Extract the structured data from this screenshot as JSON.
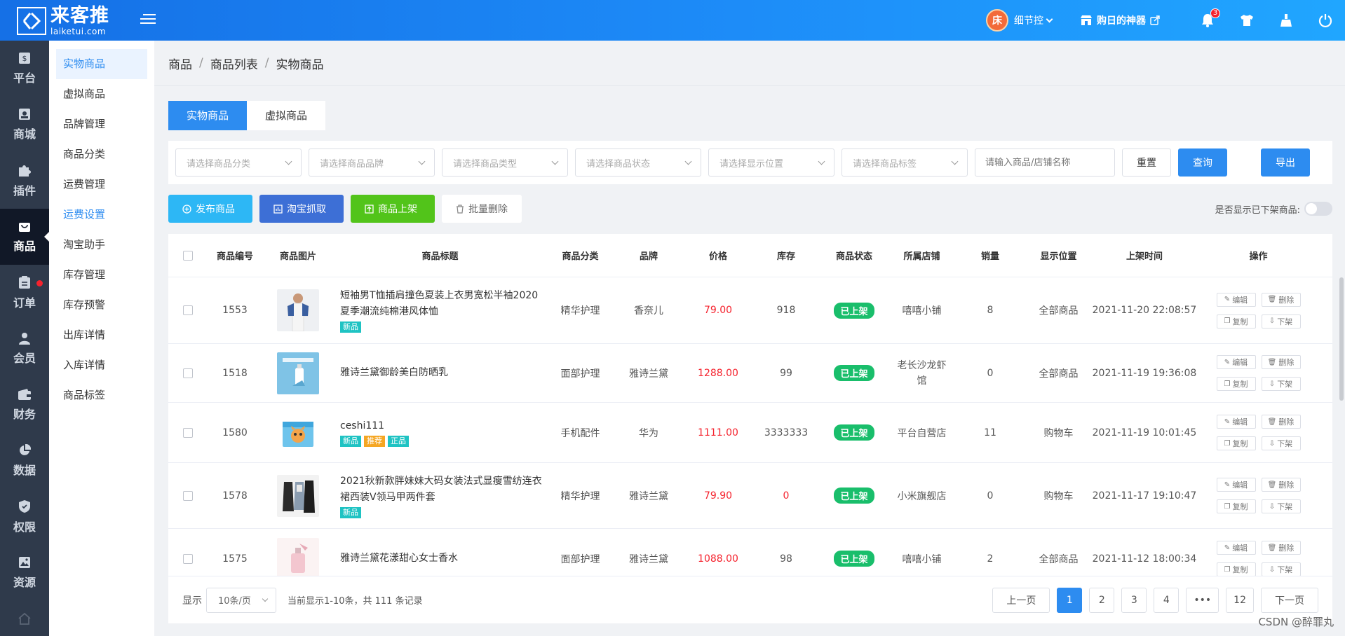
{
  "header": {
    "logo_cn": "来客推",
    "logo_en": "laiketui.com",
    "user_name": "细节控",
    "avatar_text": "床",
    "shop_name": "购日的神器",
    "notification_count": "3"
  },
  "sidebar": {
    "items": [
      {
        "label": "平台",
        "icon": "dollar-icon"
      },
      {
        "label": "商城",
        "icon": "store-icon"
      },
      {
        "label": "插件",
        "icon": "puzzle-icon"
      },
      {
        "label": "商品",
        "icon": "bag-icon",
        "active": true
      },
      {
        "label": "订单",
        "icon": "clipboard-icon"
      },
      {
        "label": "会员",
        "icon": "user-icon"
      },
      {
        "label": "财务",
        "icon": "wallet-icon"
      },
      {
        "label": "数据",
        "icon": "pie-chart-icon"
      },
      {
        "label": "权限",
        "icon": "shield-icon"
      },
      {
        "label": "资源",
        "icon": "image-icon"
      }
    ]
  },
  "subnav": {
    "items": [
      "实物商品",
      "虚拟商品",
      "品牌管理",
      "商品分类",
      "运费管理",
      "运费设置",
      "淘宝助手",
      "库存管理",
      "库存预警",
      "出库详情",
      "入库详情",
      "商品标签"
    ]
  },
  "breadcrumb": [
    "商品",
    "商品列表",
    "实物商品"
  ],
  "tabs": [
    "实物商品",
    "虚拟商品"
  ],
  "filters": {
    "category_placeholder": "请选择商品分类",
    "brand_placeholder": "请选择商品品牌",
    "type_placeholder": "请选择商品类型",
    "status_placeholder": "请选择商品状态",
    "position_placeholder": "请选择显示位置",
    "tag_placeholder": "请选择商品标签",
    "search_placeholder": "请输入商品/店铺名称",
    "reset_label": "重置",
    "query_label": "查询",
    "export_label": "导出"
  },
  "actions": {
    "publish": "发布商品",
    "taobao": "淘宝抓取",
    "listing": "商品上架",
    "batch_delete": "批量删除",
    "show_offline_label": "是否显示已下架商品:"
  },
  "table": {
    "columns": [
      "商品编号",
      "商品图片",
      "商品标题",
      "商品分类",
      "品牌",
      "价格",
      "库存",
      "商品状态",
      "所属店铺",
      "销量",
      "显示位置",
      "上架时间",
      "操作"
    ],
    "op_labels": {
      "edit": "编辑",
      "delete": "删除",
      "copy": "复制",
      "offline": "下架"
    },
    "rows": [
      {
        "id": "1553",
        "title": "短袖男T恤插肩撞色夏装上衣男宽松半袖2020夏季潮流纯棉港风体恤",
        "tags": [
          "新品"
        ],
        "category": "精华护理",
        "brand": "香奈儿",
        "price": "79.00",
        "stock": "918",
        "status": "已上架",
        "store": "嘻嘻小铺",
        "sales": "8",
        "position": "全部商品",
        "time": "2021-11-20 22:08:57"
      },
      {
        "id": "1518",
        "title": "雅诗兰黛御龄美白防晒乳",
        "tags": [],
        "category": "面部护理",
        "brand": "雅诗兰黛",
        "price": "1288.00",
        "stock": "99",
        "status": "已上架",
        "store": "老长沙龙虾馆",
        "sales": "0",
        "position": "全部商品",
        "time": "2021-11-19 19:36:08"
      },
      {
        "id": "1580",
        "title": "ceshi111",
        "tags": [
          "新品",
          "推荐",
          "正品"
        ],
        "category": "手机配件",
        "brand": "华为",
        "price": "1111.00",
        "stock": "3333333",
        "status": "已上架",
        "store": "平台自营店",
        "sales": "11",
        "position": "购物车",
        "time": "2021-11-19 10:01:45"
      },
      {
        "id": "1578",
        "title": "2021秋新款胖妹妹大码女装法式显瘦雪纺连衣裙西装V领马甲两件套",
        "tags": [
          "新品"
        ],
        "category": "精华护理",
        "brand": "雅诗兰黛",
        "price": "79.90",
        "stock": "0",
        "status": "已上架",
        "store": "小米旗舰店",
        "sales": "0",
        "position": "购物车",
        "time": "2021-11-17 19:10:47"
      },
      {
        "id": "1575",
        "title": "雅诗兰黛花漾甜心女士香水",
        "tags": [],
        "category": "面部护理",
        "brand": "雅诗兰黛",
        "price": "1088.00",
        "stock": "98",
        "status": "已上架",
        "store": "嘻嘻小铺",
        "sales": "2",
        "position": "全部商品",
        "time": "2021-11-12 18:00:34"
      }
    ]
  },
  "pager": {
    "show_label": "显示",
    "page_size": "10条/页",
    "summary": "当前显示1-10条，共 111 条记录",
    "prev": "上一页",
    "next": "下一页",
    "pages": [
      "1",
      "2",
      "3",
      "4",
      "•••",
      "12"
    ],
    "current": "1"
  },
  "watermark": "CSDN @醉罪丸",
  "colors": {
    "primary": "#2d8cf0",
    "publish": "#2db7f5",
    "taobao": "#3d6fd6",
    "listing": "#52c41a",
    "status_green": "#19be6b",
    "price_red": "#f5222d"
  }
}
